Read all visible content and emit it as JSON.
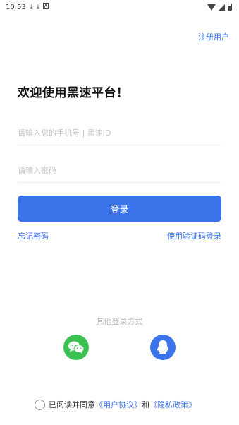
{
  "status_bar": {
    "time": "10:53",
    "icons_left": [
      "download-icon",
      "download-icon",
      "a-icon"
    ],
    "icons_right": [
      "wifi-icon",
      "signal-icon",
      "battery-icon"
    ]
  },
  "header": {
    "register_label": "注册用户"
  },
  "main": {
    "welcome": "欢迎使用黑速平台！",
    "phone_placeholder": "请输入您的手机号 | 黑速ID",
    "password_placeholder": "请输入密码",
    "login_label": "登录",
    "forgot_label": "忘记密码",
    "code_login_label": "使用验证码登录"
  },
  "other_login": {
    "title": "其他登录方式",
    "methods": [
      "wechat-icon",
      "qq-icon"
    ]
  },
  "agreement": {
    "prefix": "已阅读并同意",
    "user_agreement": "《用户协议》",
    "and": "和",
    "privacy_policy": "《隐私政策》"
  },
  "colors": {
    "accent": "#3a73ea",
    "wechat": "#3bc152"
  }
}
